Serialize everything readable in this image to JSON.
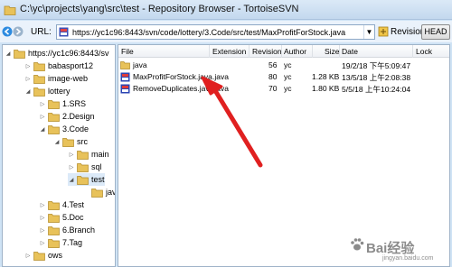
{
  "window": {
    "title": "C:\\yc\\projects\\yang\\src\\test - Repository Browser - TortoiseSVN"
  },
  "urlbar": {
    "label": "URL:",
    "value": "https://yc1c96:8443/svn/code/lottery/3.Code/src/test/MaxProfitForStock.java",
    "revision_label": "Revision:",
    "head_button": "HEAD"
  },
  "tree": {
    "nodes": [
      {
        "label": "https://yc1c96:8443/sv",
        "twisty": "◢"
      },
      {
        "label": "babasport12",
        "twisty": "▷"
      },
      {
        "label": "image-web",
        "twisty": "▷"
      },
      {
        "label": "lottery",
        "twisty": "◢"
      },
      {
        "label": "1.SRS",
        "twisty": "▷"
      },
      {
        "label": "2.Design",
        "twisty": "▷"
      },
      {
        "label": "3.Code",
        "twisty": "◢"
      },
      {
        "label": "src",
        "twisty": "◢"
      },
      {
        "label": "main",
        "twisty": "▷"
      },
      {
        "label": "sql",
        "twisty": "▷"
      },
      {
        "label": "test",
        "twisty": "◢"
      },
      {
        "label": "java",
        "twisty": ""
      },
      {
        "label": "4.Test",
        "twisty": "▷"
      },
      {
        "label": "5.Doc",
        "twisty": "▷"
      },
      {
        "label": "6.Branch",
        "twisty": "▷"
      },
      {
        "label": "7.Tag",
        "twisty": "▷"
      },
      {
        "label": "ows",
        "twisty": "▷"
      }
    ]
  },
  "files": {
    "columns": [
      "File",
      "Extension",
      "Revision",
      "Author",
      "Size",
      "Date",
      "Lock"
    ],
    "rows": [
      {
        "file": "java",
        "extension": "",
        "revision": "56",
        "author": "yc",
        "size": "",
        "date": "19/2/18 下午5:09:47",
        "lock": "",
        "icon": "folder-icon"
      },
      {
        "file": "MaxProfitForStock.java",
        "extension": ".java",
        "revision": "80",
        "author": "yc",
        "size": "1.28 KB",
        "date": "13/5/18 上午2:08:38",
        "lock": "",
        "icon": "java-file-icon"
      },
      {
        "file": "RemoveDuplicates.java",
        "extension": ".java",
        "revision": "70",
        "author": "yc",
        "size": "1.80 KB",
        "date": "5/5/18 上午10:24:04",
        "lock": "",
        "icon": "java-file-icon"
      }
    ]
  },
  "watermark": {
    "text": "Bai经验",
    "sub": "jingyan.baidu.com"
  },
  "colors": {
    "folder": "#e8c25a",
    "arrow": "#e02020",
    "titlebar": "#c3d8ee"
  }
}
